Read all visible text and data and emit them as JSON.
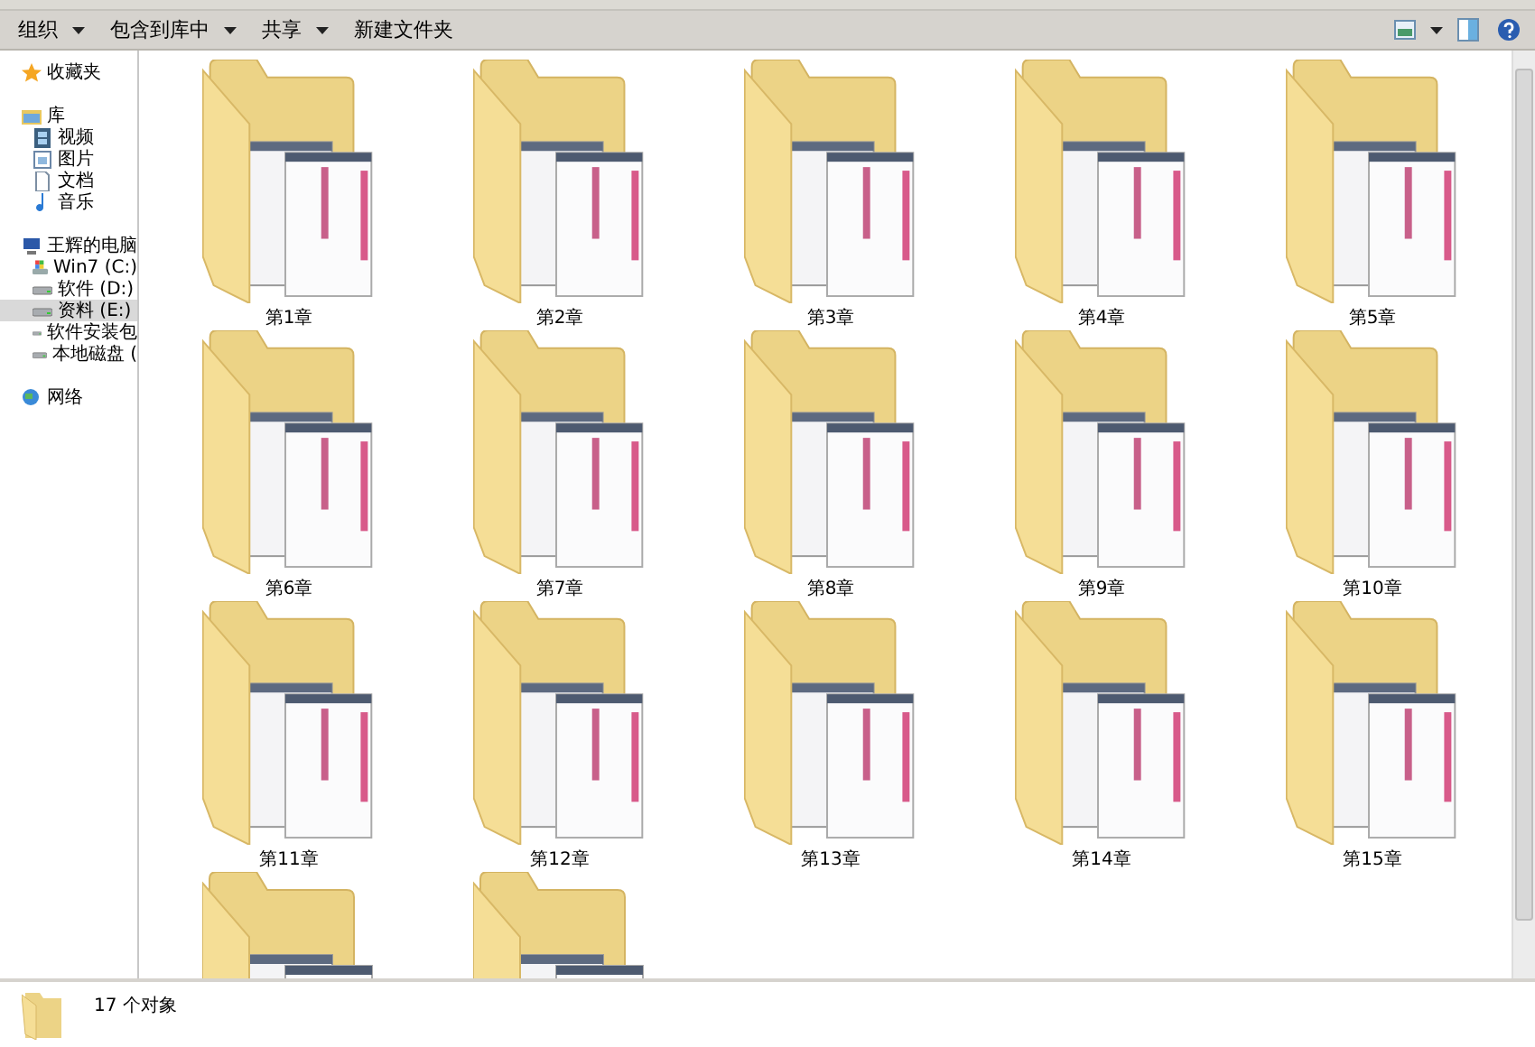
{
  "toolbar": {
    "items": [
      {
        "label": "组织",
        "dropdown": true
      },
      {
        "label": "包含到库中",
        "dropdown": true
      },
      {
        "label": "共享",
        "dropdown": true
      },
      {
        "label": "新建文件夹",
        "dropdown": false
      }
    ]
  },
  "sidebar": {
    "groups": [
      {
        "label": "收藏夹",
        "kind": "star",
        "selected": false
      },
      {
        "label": "库",
        "kind": "library",
        "selected": false,
        "children": [
          {
            "label": "视频",
            "kind": "video",
            "selected": false
          },
          {
            "label": "图片",
            "kind": "picture",
            "selected": false
          },
          {
            "label": "文档",
            "kind": "document",
            "selected": false
          },
          {
            "label": "音乐",
            "kind": "music",
            "selected": false
          }
        ]
      },
      {
        "label": "王辉的电脑",
        "kind": "computer",
        "selected": false,
        "children": [
          {
            "label": "Win7 (C:)",
            "kind": "system-drive",
            "selected": false
          },
          {
            "label": "软件 (D:)",
            "kind": "drive",
            "selected": false
          },
          {
            "label": "资料 (E:)",
            "kind": "drive",
            "selected": true
          },
          {
            "label": "软件安装包",
            "kind": "drive",
            "selected": false
          },
          {
            "label": "本地磁盘 (",
            "kind": "drive",
            "selected": false
          }
        ]
      },
      {
        "label": "网络",
        "kind": "network",
        "selected": false
      }
    ]
  },
  "folders": [
    {
      "kind": "folder",
      "label": "第1章"
    },
    {
      "kind": "folder",
      "label": "第2章"
    },
    {
      "kind": "folder",
      "label": "第3章"
    },
    {
      "kind": "folder",
      "label": "第4章"
    },
    {
      "kind": "folder",
      "label": "第5章"
    },
    {
      "kind": "folder",
      "label": "第6章"
    },
    {
      "kind": "folder",
      "label": "第7章"
    },
    {
      "kind": "folder",
      "label": "第8章"
    },
    {
      "kind": "folder",
      "label": "第9章"
    },
    {
      "kind": "folder",
      "label": "第10章"
    },
    {
      "kind": "folder",
      "label": "第11章"
    },
    {
      "kind": "folder",
      "label": "第12章"
    },
    {
      "kind": "folder",
      "label": "第13章"
    },
    {
      "kind": "folder",
      "label": "第14章"
    },
    {
      "kind": "folder",
      "label": "第15章"
    },
    {
      "kind": "folder"
    },
    {
      "kind": "folder"
    }
  ],
  "status_bar": {
    "text": "17 个对象"
  }
}
